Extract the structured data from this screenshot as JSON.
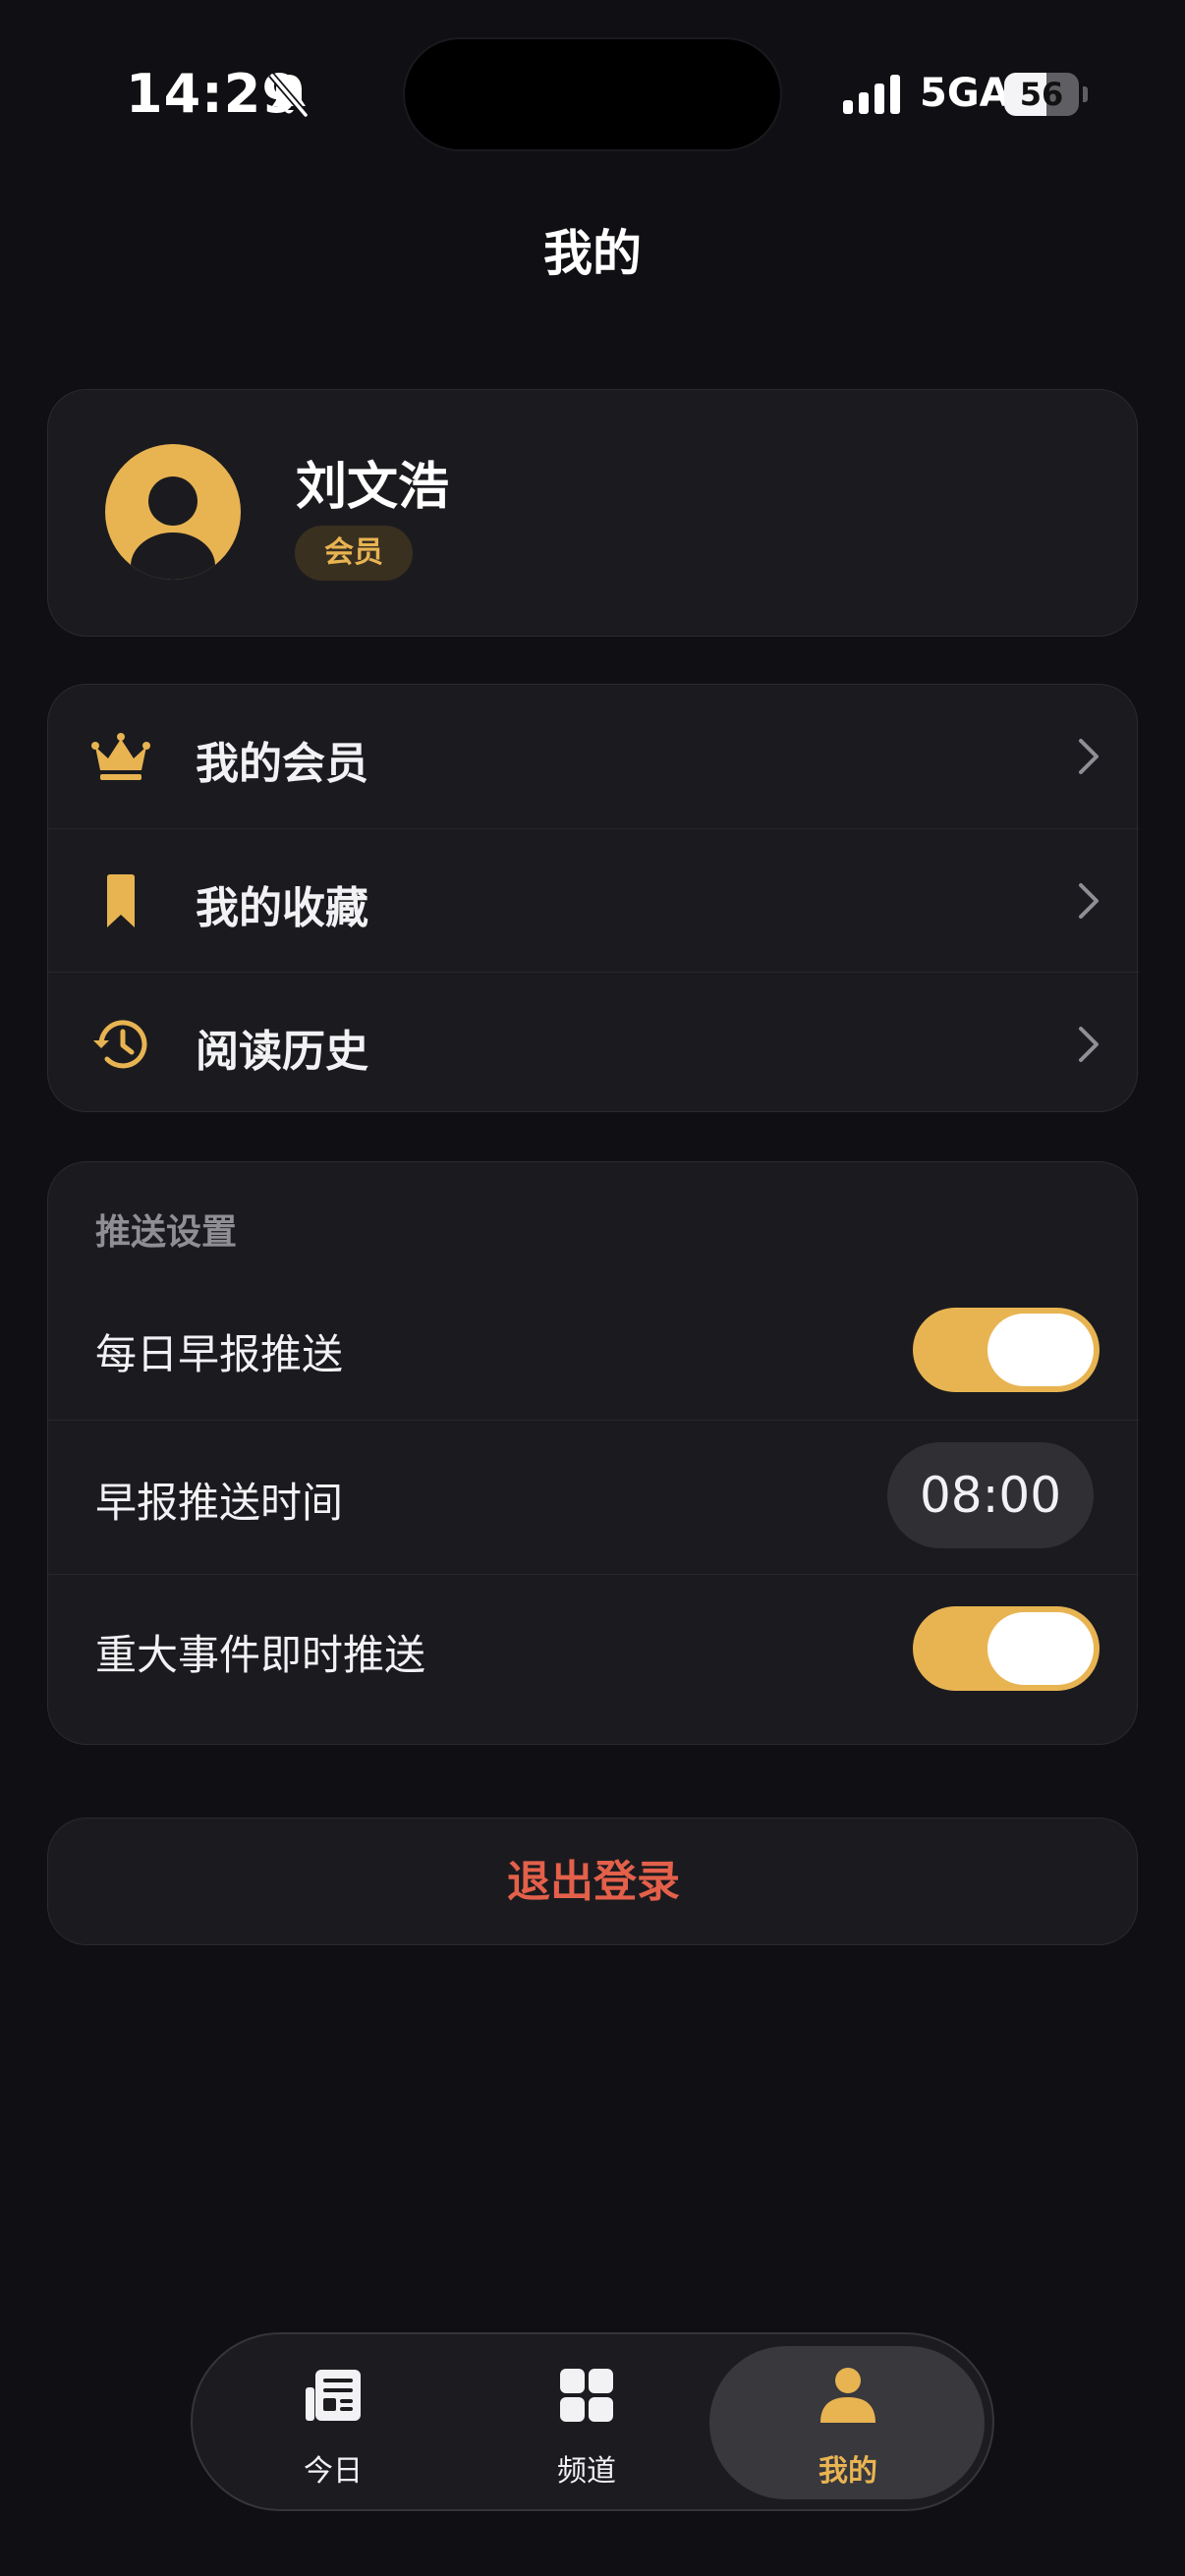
{
  "status_bar": {
    "time": "14:29",
    "network": "5GA",
    "battery": "56",
    "battery_level": 0.56,
    "icons": [
      "bell-slash-icon",
      "cellular-signal-icon",
      "battery-icon"
    ]
  },
  "header": {
    "title": "我的"
  },
  "profile": {
    "name": "刘文浩",
    "badge": "会员",
    "avatar_icon": "user-avatar-icon"
  },
  "menu": {
    "items": [
      {
        "label": "我的会员",
        "icon": "crown-icon"
      },
      {
        "label": "我的收藏",
        "icon": "bookmark-icon"
      },
      {
        "label": "阅读历史",
        "icon": "history-icon"
      }
    ]
  },
  "push_settings": {
    "title": "推送设置",
    "daily_push": {
      "label": "每日早报推送",
      "enabled": true
    },
    "push_time": {
      "label": "早报推送时间",
      "value": "08:00"
    },
    "breaking_push": {
      "label": "重大事件即时推送",
      "enabled": true
    }
  },
  "logout": {
    "label": "退出登录"
  },
  "tab_bar": {
    "tabs": [
      {
        "label": "今日",
        "icon": "newspaper-icon",
        "active": false
      },
      {
        "label": "频道",
        "icon": "grid-icon",
        "active": false
      },
      {
        "label": "我的",
        "icon": "person-icon",
        "active": true
      }
    ]
  },
  "colors": {
    "background": "#101014",
    "card": "#1b1b1f",
    "accent": "#e8b452",
    "danger": "#e4604a",
    "secondary_text": "#8e8e94"
  }
}
